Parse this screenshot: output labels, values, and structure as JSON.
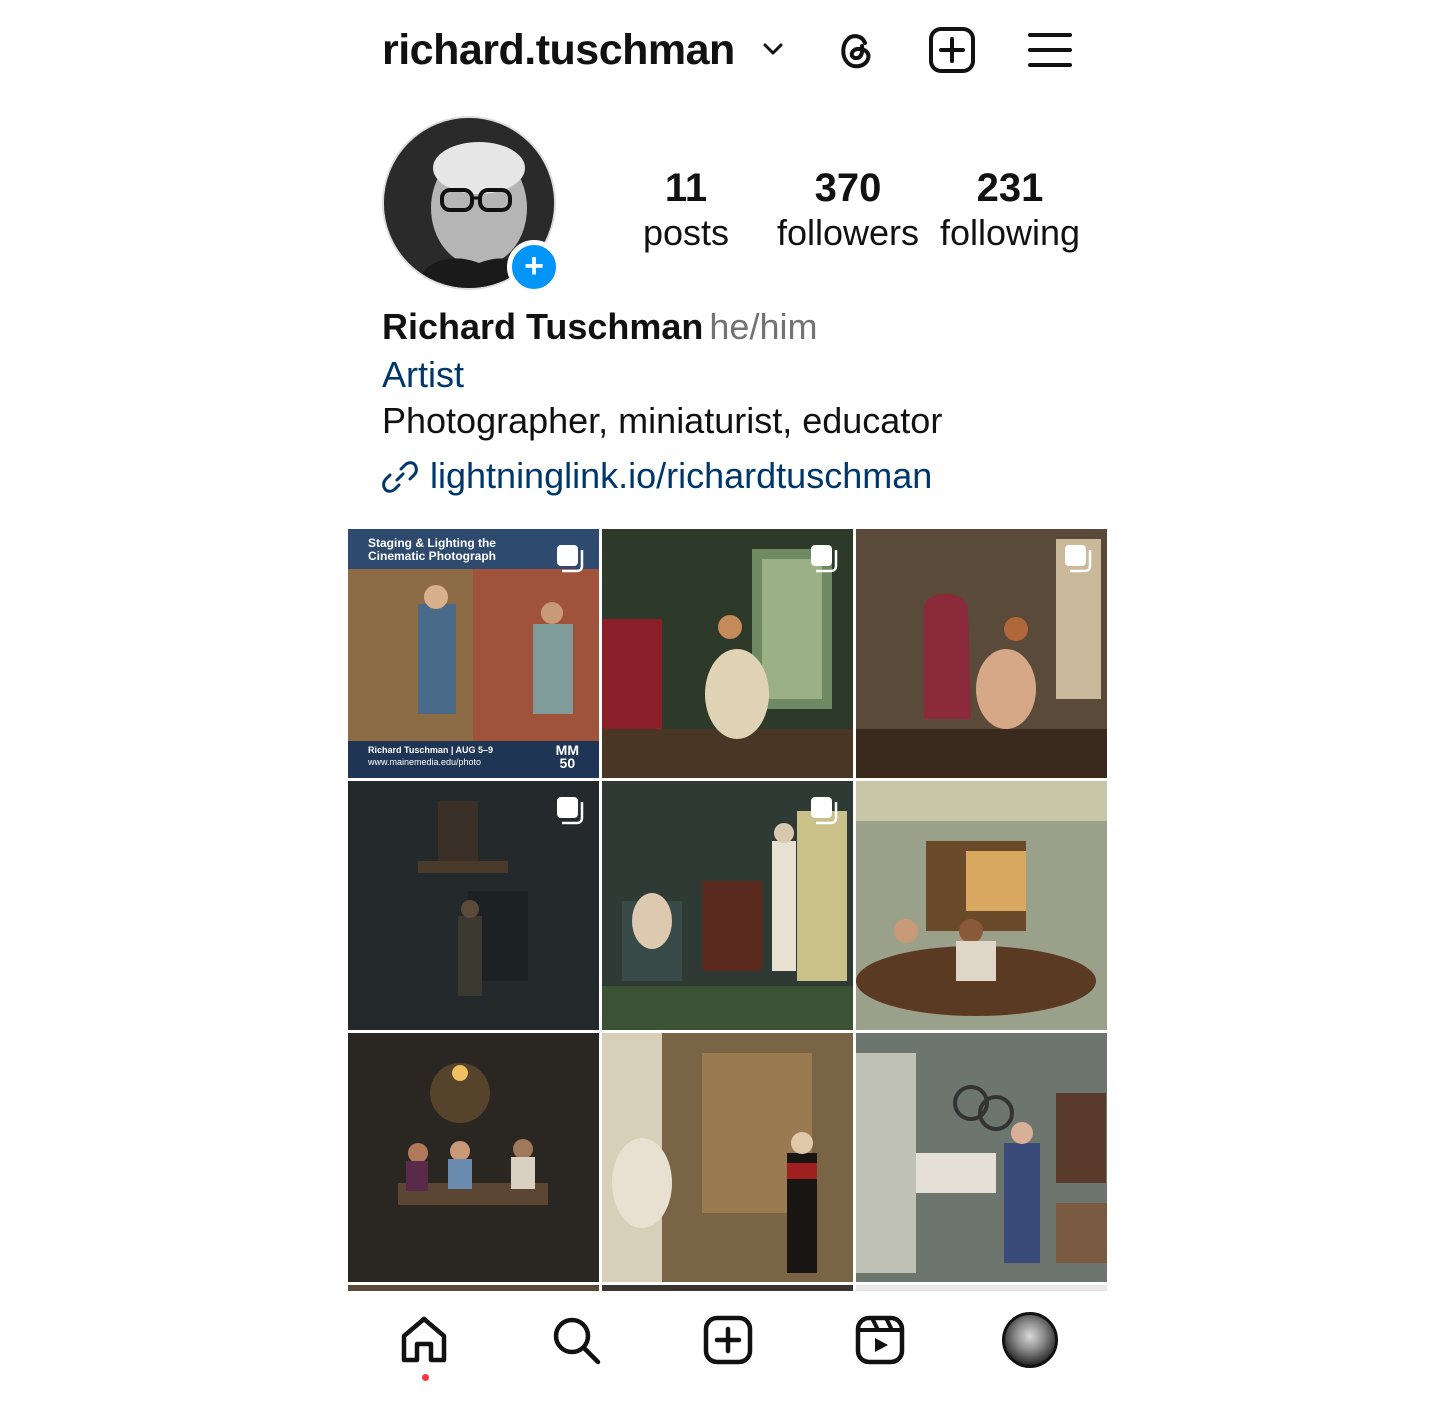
{
  "header": {
    "username": "richard.tuschman"
  },
  "profile": {
    "stats": [
      {
        "value": "11",
        "label": "posts"
      },
      {
        "value": "370",
        "label": "followers"
      },
      {
        "value": "231",
        "label": "following"
      }
    ],
    "display_name": "Richard Tuschman",
    "pronouns": "he/him",
    "category": "Artist",
    "bio": "Photographer, miniaturist, educator",
    "link": "lightninglink.io/richardtuschman"
  },
  "grid": {
    "cover_post": {
      "title_line1": "Staging & Lighting the",
      "title_line2": "Cinematic Photograph",
      "footer_line1": "Richard Tuschman  |  AUG 5–9",
      "footer_line2": "www.mainemedia.edu/photo",
      "logo_line1": "MM",
      "logo_line2": "50"
    }
  },
  "colors": {
    "accent": "#0095f6",
    "link": "#00376b",
    "notification_dot": "#ff3040"
  },
  "icons": [
    "chevron-down-icon",
    "threads-icon",
    "create-icon",
    "menu-icon",
    "link-icon",
    "carousel-icon",
    "home-icon",
    "search-icon",
    "reels-icon"
  ]
}
